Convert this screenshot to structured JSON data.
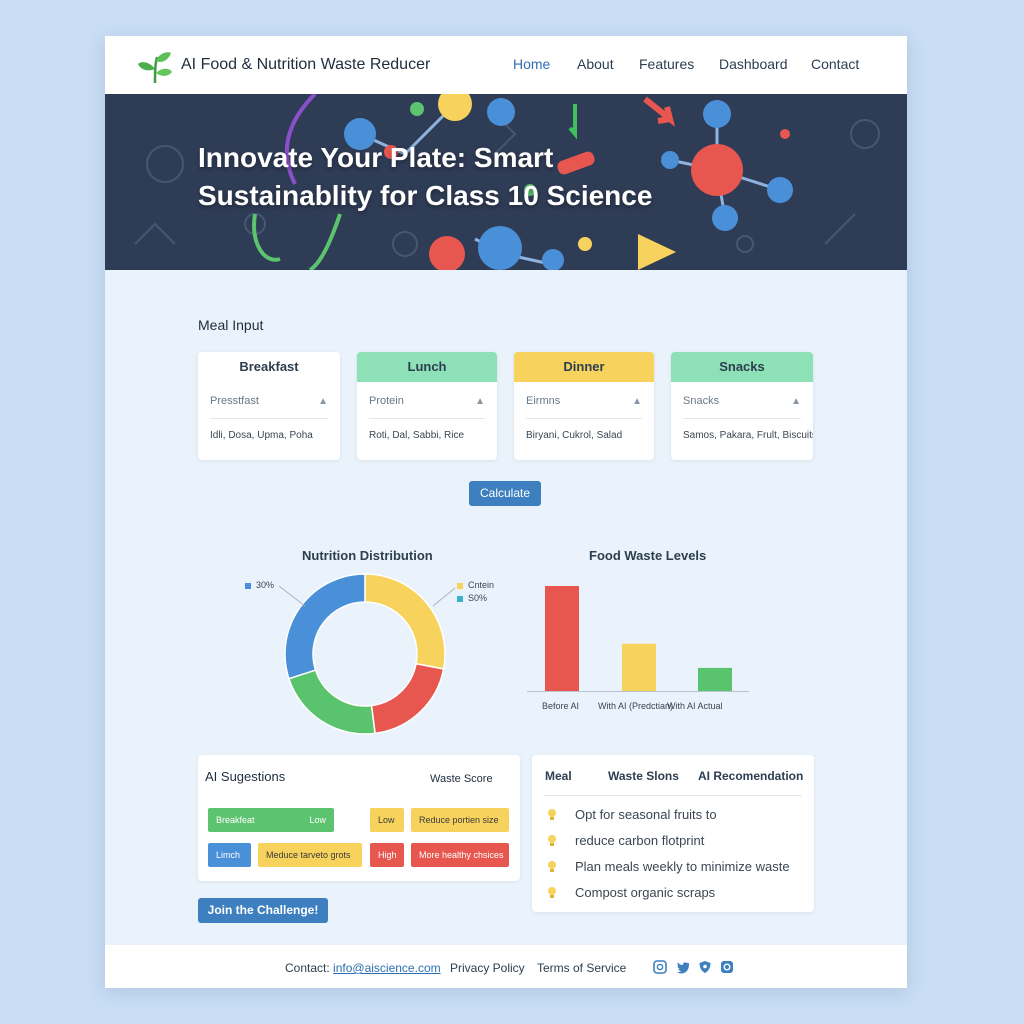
{
  "header": {
    "app_title": "AI Food & Nutrition Waste Reducer",
    "nav": [
      "Home",
      "About",
      "Features",
      "Dashboard",
      "Contact"
    ]
  },
  "hero": {
    "title": "Innovate Your Plate: Smart Sustainablity for Class 10 Science"
  },
  "meal_input": {
    "title": "Meal Input",
    "meals": [
      {
        "label": "Breakfast",
        "select": "Presstfast",
        "foods": "Idli, Dosa, Upma, Poha",
        "color": "#ffffff"
      },
      {
        "label": "Lunch",
        "select": "Protein",
        "foods": "Roti, Dal, Sabbi, Rice",
        "color": "#8ee0b6"
      },
      {
        "label": "Dinner",
        "select": "Eirmns",
        "foods": "Biryani, Cukrol, Salad",
        "color": "#f7d25c"
      },
      {
        "label": "Snacks",
        "select": "Snacks",
        "foods": "Samos, Pakara, Frult, Biscuits",
        "color": "#8ee0b6"
      }
    ],
    "calculate_label": "Calculate"
  },
  "chart_data": [
    {
      "type": "pie",
      "title": "Nutrition Distribution",
      "values": [
        30,
        22,
        20,
        28
      ],
      "colors": [
        "#4a90d9",
        "#59c46d",
        "#e8574f",
        "#f7d25c"
      ],
      "legend": [
        {
          "label": "30%",
          "color": "#4a90d9"
        },
        {
          "label": "Cntein",
          "color": "#f7d25c"
        },
        {
          "label": "S0%",
          "color": "#3bb0c9"
        }
      ]
    },
    {
      "type": "bar",
      "title": "Food Waste Levels",
      "categories": [
        "Before AI",
        "With AI (Predctian)",
        "With AI Actual"
      ],
      "values": [
        100,
        45,
        22
      ],
      "colors": [
        "#e8574f",
        "#f7d25c",
        "#59c46d"
      ],
      "ylim": [
        0,
        100
      ]
    }
  ],
  "suggestions": {
    "title": "AI Sugestions",
    "score_label": "Waste Score",
    "rows": [
      {
        "meal": "Breakfeat",
        "level": "Low",
        "score": "Low",
        "action": "Reduce portien size",
        "meal_color": "#5cc36f",
        "score_color": "#f7d25c",
        "action_color": "#f7d25c"
      },
      {
        "meal": "Limch",
        "level": "",
        "score": "High",
        "action": "More healthy chsices",
        "extra": "Meduce tarveto grots",
        "meal_color": "#4a90d9",
        "extra_color": "#f7d25c",
        "score_color": "#e8574f",
        "action_color": "#e8574f"
      }
    ],
    "join_label": "Join the Challenge!"
  },
  "recommendations": {
    "headers": [
      "Meal",
      "Waste Slons",
      "AI Recomendation"
    ],
    "items": [
      "Opt for seasonal fruits to",
      "reduce carbon flotprint",
      "Plan meals weekly to minimize waste",
      "Compost organic scraps"
    ]
  },
  "footer": {
    "contact_label": "Contact:",
    "email": "info@aiscience.com",
    "privacy": "Privacy Policy",
    "terms": "Terms of Service",
    "social": [
      "instagram-icon",
      "twitter-icon",
      "shield-icon",
      "camera-icon"
    ]
  }
}
